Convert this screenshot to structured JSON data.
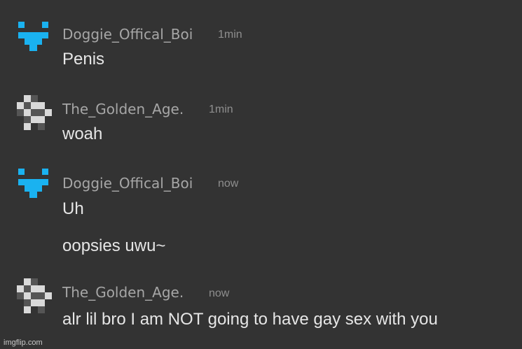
{
  "messages": [
    {
      "username": "Doggie_Offical_Boi",
      "time": "1min",
      "avatar": "blue-pixel-face-icon",
      "lines": [
        "Penis"
      ]
    },
    {
      "username": "The_Golden_Age.",
      "time": "1min",
      "avatar": "gray-pixel-pattern-icon",
      "lines": [
        "woah"
      ]
    },
    {
      "username": "Doggie_Offical_Boi",
      "time": "now",
      "avatar": "blue-pixel-face-icon",
      "lines": [
        "Uh",
        "oopsies uwu~"
      ]
    },
    {
      "username": "The_Golden_Age.",
      "time": "now",
      "avatar": "gray-pixel-pattern-icon",
      "lines": [
        "alr lil bro I am NOT going to have gay sex with you"
      ]
    }
  ],
  "watermark": "imgflip.com",
  "colors": {
    "background": "#333333",
    "username": "#a6a6a6",
    "timestamp": "#8f8f8f",
    "message_text": "#e6e6e6",
    "blue_avatar": "#1ab2f0",
    "gray_avatar_light": "#d9d9d9",
    "gray_avatar_dark": "#555555"
  }
}
